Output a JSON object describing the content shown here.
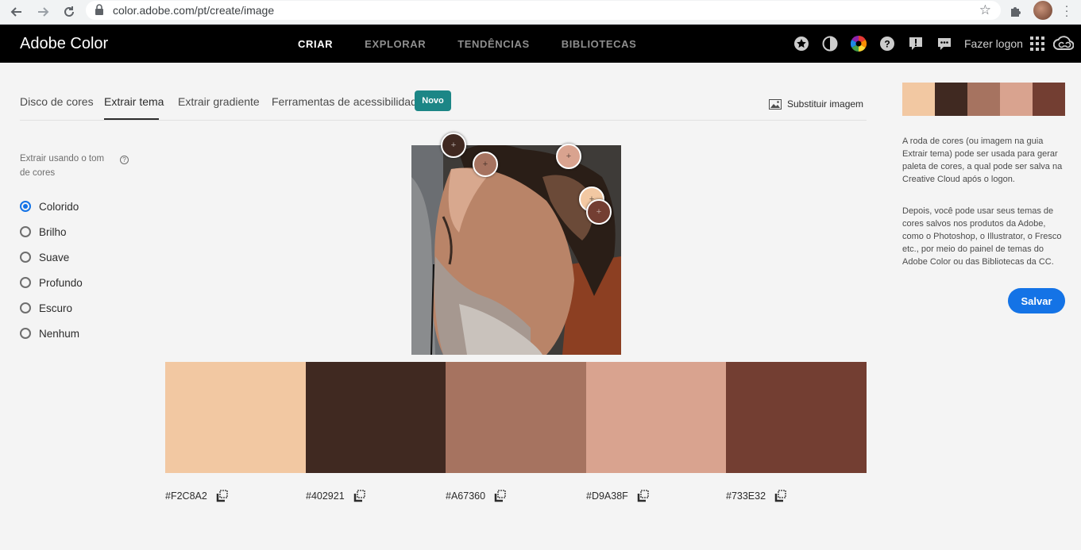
{
  "browser": {
    "url": "color.adobe.com/pt/create/image",
    "icons": [
      "back-arrow-icon",
      "forward-arrow-icon",
      "reload-icon",
      "lock-icon",
      "bookmark-star-icon",
      "extensions-puzzle-icon",
      "profile-avatar",
      "kebab-menu-icon"
    ]
  },
  "header": {
    "brand": "Adobe Color",
    "nav": [
      {
        "label": "CRIAR",
        "active": true
      },
      {
        "label": "EXPLORAR",
        "active": false
      },
      {
        "label": "TENDÊNCIAS",
        "active": false
      },
      {
        "label": "BIBLIOTECAS",
        "active": false
      }
    ],
    "icons": [
      "badge-star-icon",
      "contrast-half-circle-icon",
      "color-wheel-icon",
      "help-icon",
      "alert-icon",
      "feedback-chat-icon"
    ],
    "login": "Fazer logon",
    "apps_icon": "app-grid-icon",
    "cc_icon": "creative-cloud-icon"
  },
  "tabs": {
    "items": [
      "Disco de cores",
      "Extrair tema",
      "Extrair gradiente",
      "Ferramentas de acessibilidade"
    ],
    "active_index": 1,
    "new_badge": "Novo",
    "replace_image": "Substituir imagem"
  },
  "mood": {
    "title": "Extrair usando o tom de cores",
    "options": [
      "Colorido",
      "Brilho",
      "Suave",
      "Profundo",
      "Escuro",
      "Nenhum"
    ],
    "selected_index": 0
  },
  "theme": {
    "colors": [
      "#F2C8A2",
      "#402921",
      "#A67360",
      "#D9A38F",
      "#733E32"
    ]
  },
  "panel": {
    "info_1": "A roda de cores (ou imagem na guia Extrair tema) pode ser usada para gerar paleta de cores, a qual pode ser salva na Creative Cloud após o logon.",
    "info_2": "Depois, você pode usar seus temas de cores salvos nos produtos da Adobe, como o Photoshop, o Illustrator, o Fresco etc., por meio do painel de temas do Adobe Color ou das Bibliotecas da CC.",
    "save": "Salvar"
  },
  "colors": {
    "accent": "#1473e6",
    "badge": "#1c8686",
    "appbar": "#000000"
  }
}
